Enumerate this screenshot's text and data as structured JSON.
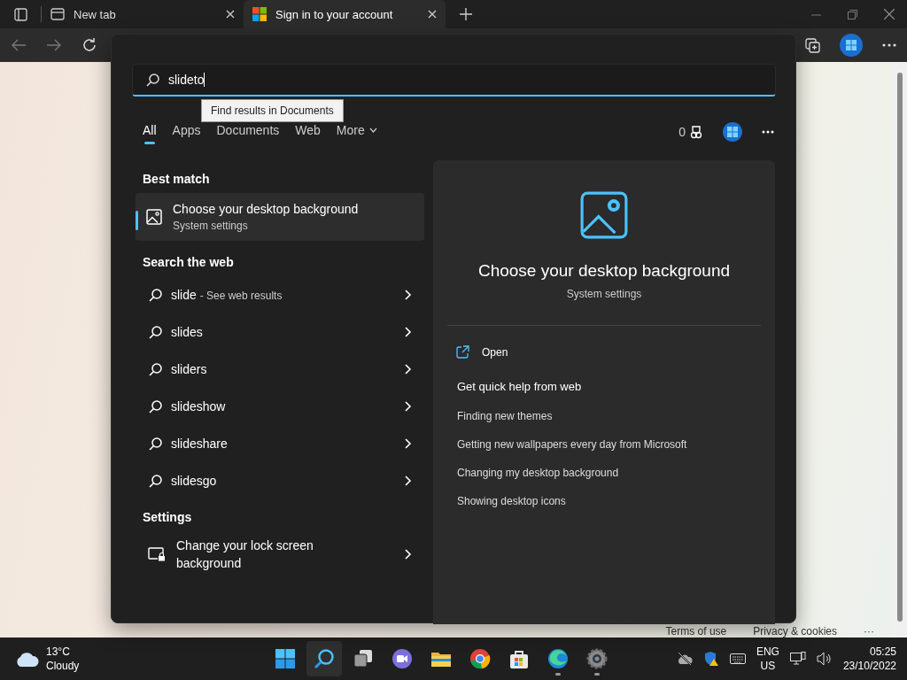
{
  "browser": {
    "tabs": [
      {
        "title": "New tab",
        "kind": "newtab",
        "selected": false
      },
      {
        "title": "Sign in to your account",
        "kind": "microsoft",
        "selected": true
      }
    ]
  },
  "page": {
    "footer_links": [
      "Terms of use",
      "Privacy & cookies",
      "···"
    ]
  },
  "search": {
    "query": "slideto",
    "tooltip": "Find results in Documents",
    "filters": [
      {
        "label": "All",
        "kind": "tab",
        "selected": true
      },
      {
        "label": "Apps",
        "kind": "tab",
        "selected": false
      },
      {
        "label": "Documents",
        "kind": "tab",
        "selected": false
      },
      {
        "label": "Web",
        "kind": "tab",
        "selected": false
      },
      {
        "label": "More",
        "kind": "dropdown",
        "selected": false
      }
    ],
    "points": "0",
    "best_match_heading": "Best match",
    "best_match": {
      "title": "Choose your desktop background",
      "subtitle": "System settings",
      "selected": true
    },
    "web_heading": "Search the web",
    "web_results": [
      {
        "text": "slide",
        "note": "- See web results"
      },
      {
        "text": "slides"
      },
      {
        "text": "sliders"
      },
      {
        "text": "slideshow"
      },
      {
        "text": "slideshare"
      },
      {
        "text": "slidesgo"
      }
    ],
    "settings_heading": "Settings",
    "settings_results": [
      {
        "text": "Change your lock screen background"
      }
    ],
    "preview": {
      "title": "Choose your desktop background",
      "subtitle": "System settings",
      "actions": [
        "Open"
      ],
      "help_heading": "Get quick help from web",
      "help_links": [
        "Finding new themes",
        "Getting new wallpapers every day from Microsoft",
        "Changing my desktop background",
        "Showing desktop icons"
      ]
    }
  },
  "taskbar": {
    "weather": {
      "temp": "13°C",
      "condition": "Cloudy"
    },
    "apps": [
      {
        "kind": "start",
        "selected": false,
        "running": false
      },
      {
        "kind": "search",
        "selected": true,
        "running": false
      },
      {
        "kind": "taskview",
        "selected": false,
        "running": false
      },
      {
        "kind": "chat",
        "selected": false,
        "running": false
      },
      {
        "kind": "folder",
        "selected": false,
        "running": false
      },
      {
        "kind": "chrome",
        "selected": false,
        "running": false
      },
      {
        "kind": "store",
        "selected": false,
        "running": false
      },
      {
        "kind": "edge",
        "selected": false,
        "running": true
      },
      {
        "kind": "settings",
        "selected": false,
        "running": true
      }
    ],
    "language": "ENG",
    "region": "US",
    "time": "05:25",
    "date": "23/10/2022"
  }
}
